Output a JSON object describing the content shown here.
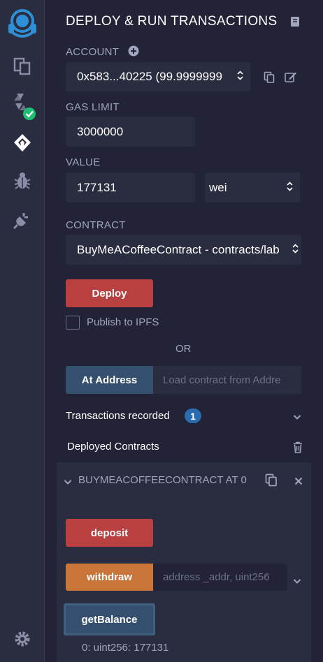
{
  "app": {
    "title": "DEPLOY & RUN TRANSACTIONS"
  },
  "icons": {
    "sidebar": [
      "remix-logo-icon",
      "file-explorer-icon",
      "solidity-compiler-icon",
      "deploy-run-icon",
      "debugger-icon",
      "plugin-manager-icon",
      "settings-icon"
    ]
  },
  "account": {
    "label": "ACCOUNT",
    "value": "0x583...40225 (99.9999999"
  },
  "gas_limit": {
    "label": "GAS LIMIT",
    "value": "3000000"
  },
  "value_field": {
    "label": "VALUE",
    "amount": "177131",
    "unit": "wei"
  },
  "contract": {
    "label": "CONTRACT",
    "selected": "BuyMeACoffeeContract - contracts/lab"
  },
  "deploy": {
    "button": "Deploy",
    "publish_label": "Publish to IPFS",
    "or_label": "OR"
  },
  "at_address": {
    "button": "At Address",
    "placeholder": "Load contract from Addre"
  },
  "transactions": {
    "label": "Transactions recorded",
    "count": "1"
  },
  "deployed": {
    "label": "Deployed Contracts",
    "instance_title": "BUYMEACOFFEECONTRACT AT 0",
    "functions": {
      "deposit": "deposit",
      "withdraw": "withdraw",
      "withdraw_placeholder": "address _addr, uint256",
      "get_balance": "getBalance"
    },
    "result": "0: uint256: 177131"
  },
  "colors": {
    "background": "#222336",
    "panel": "#2a2c3f",
    "deploy_red": "#b84040",
    "withdraw_orange": "#c97539",
    "call_blue": "#35506e",
    "badge": "#2b6cb0",
    "success_green": "#1dbf73"
  }
}
